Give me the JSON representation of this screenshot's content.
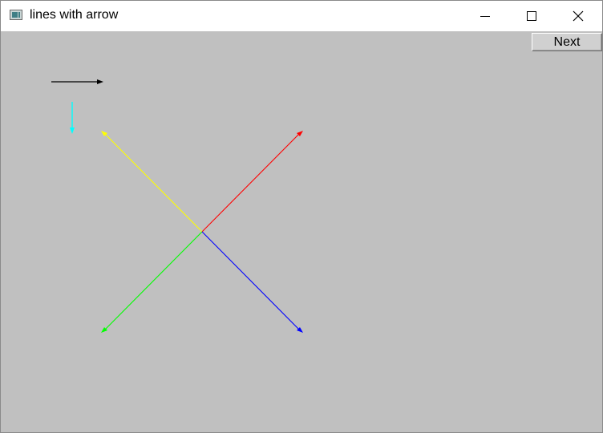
{
  "window": {
    "title": "lines with arrow",
    "icon": "app-window-icon",
    "controls": [
      "minimize-icon",
      "maximize-icon",
      "close-icon"
    ]
  },
  "client": {
    "background": "#c0c0c0",
    "next_label": "Next"
  },
  "arrows": [
    {
      "name": "arrow-black-right",
      "color": "#000000"
    },
    {
      "name": "arrow-cyan-down",
      "color": "#00ffff"
    },
    {
      "name": "arrow-red-upright",
      "color": "#ff0000"
    },
    {
      "name": "arrow-yellow-upleft",
      "color": "#ffff00"
    },
    {
      "name": "arrow-green-downleft",
      "color": "#00ff00"
    },
    {
      "name": "arrow-blue-downright",
      "color": "#0000ff"
    }
  ]
}
